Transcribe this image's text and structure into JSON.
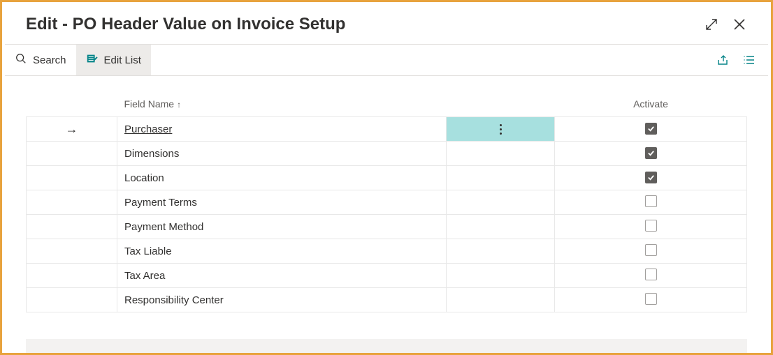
{
  "header": {
    "title": "Edit - PO Header Value on Invoice Setup"
  },
  "toolbar": {
    "search_label": "Search",
    "edit_list_label": "Edit List"
  },
  "grid": {
    "columns": {
      "field_name": "Field Name",
      "activate": "Activate"
    },
    "rows": [
      {
        "field_name": "Purchaser",
        "activate": true,
        "is_current": true
      },
      {
        "field_name": "Dimensions",
        "activate": true,
        "is_current": false
      },
      {
        "field_name": "Location",
        "activate": true,
        "is_current": false
      },
      {
        "field_name": "Payment Terms",
        "activate": false,
        "is_current": false
      },
      {
        "field_name": "Payment Method",
        "activate": false,
        "is_current": false
      },
      {
        "field_name": "Tax Liable",
        "activate": false,
        "is_current": false
      },
      {
        "field_name": "Tax Area",
        "activate": false,
        "is_current": false
      },
      {
        "field_name": "Responsibility Center",
        "activate": false,
        "is_current": false
      }
    ]
  },
  "colors": {
    "accent_border": "#e8a33d",
    "teal": "#038387",
    "row_highlight": "#a7e0df"
  }
}
